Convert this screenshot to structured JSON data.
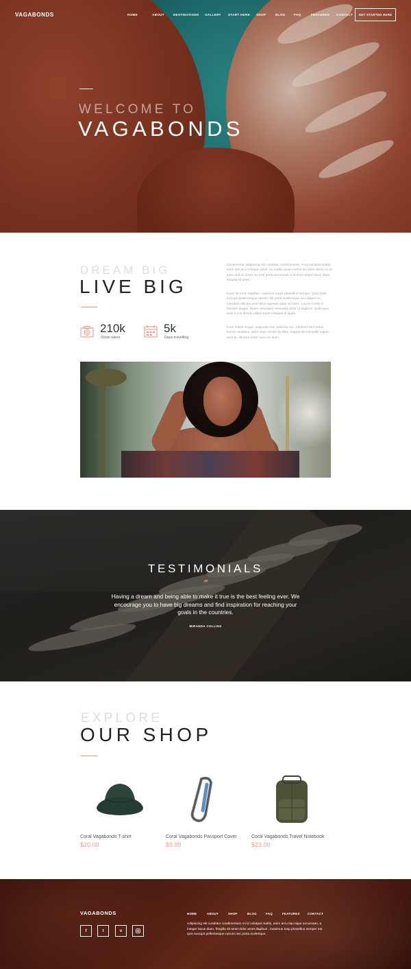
{
  "header": {
    "logo": "VAGABONDS",
    "nav": [
      "HOME",
      "ABOUT",
      "DESTINATIONS",
      "GALLERY",
      "START HERE",
      "SHOP",
      "BLOG",
      "FAQ",
      "FEATURES",
      "CONTACT"
    ],
    "cta": "GET STARTED HERE"
  },
  "hero": {
    "welcome": "WELCOME TO",
    "title": "VAGABONDS"
  },
  "intro": {
    "small": "DREAM BIG",
    "big": "LIVE BIG",
    "stats": [
      {
        "icon": "camera-icon",
        "value": "210k",
        "label": "Shots taken"
      },
      {
        "icon": "calendar-icon",
        "value": "5k",
        "label": "Days travelling"
      }
    ],
    "paragraphs": [
      "Consectetur adipiscing elit curabitur condimentum, mi id volutpat mattis, enim nisi arcu tristique dolor, eu mattis quam metus leo justo donec in ex justo sed ut, lorem eu erat porta accumsan a ut erat integer lacus diam, fringilla sit amet.",
      "Dolor sit amet dapibus, maximus turpis phasellus semper. Quis dolor suscipit pellentesque rutrum nisl porta scelerisque nisi aliquet mi, interdum efficitur erat tellus egestas dolor at lorem. Lorem mollis in hendrer augue. Etiam venenatis venenatis dolor id dapibus. Nulla quis ante a cus dictum ullamcorper volutpat et ligula.",
      "Cras mattis neque, vulputate non vehicula nec, eleifend sed metus. Donec faucibus, dolor vitae ornare facilisis, magna elit convallis sapien arcu ac ultricies tortor nunc eu diam."
    ]
  },
  "testimonials": {
    "title": "TESTIMONIALS",
    "quote_mark": "\"",
    "text": "Having a dream and being able to make it true is the best feeling ever. We encourage you to have big dreams and find inspiration for reaching your goals in the countries.",
    "author": "MIRANDA COLLINS"
  },
  "shop": {
    "small": "EXPLORE",
    "big": "OUR SHOP",
    "products": [
      {
        "name": "Coral Vagabonds T-shirt",
        "price": "$20.00",
        "image": "bucket-hat"
      },
      {
        "name": "Coral Vagabonds Passport Cover",
        "price": "$9.99",
        "image": "carabiner"
      },
      {
        "name": "Coral Vagabonds Travel Notebook",
        "price": "$23.00",
        "image": "backpack"
      }
    ]
  },
  "footer": {
    "logo": "VAGABONDS",
    "social": [
      "facebook-icon",
      "twitter-icon",
      "vimeo-icon",
      "instagram-icon"
    ],
    "nav": [
      "HOME",
      "ABOUT",
      "SHOP",
      "BLOG",
      "FAQ",
      "FEATURES",
      "CONTACT"
    ],
    "text": "Adipiscing elit curabitur condimentum mi id volutpat mattis, enim arcu tiqu tique accumsan, a integer lacus diam, fringilla sit amet dolor amet dapibus , maximus tusp phasellus semper est quis suscipit pellentesque rutrum nec porta scelerique."
  },
  "colors": {
    "accent": "#e8927e",
    "dark_text": "#222222",
    "faint_text": "#e2ddd8"
  }
}
